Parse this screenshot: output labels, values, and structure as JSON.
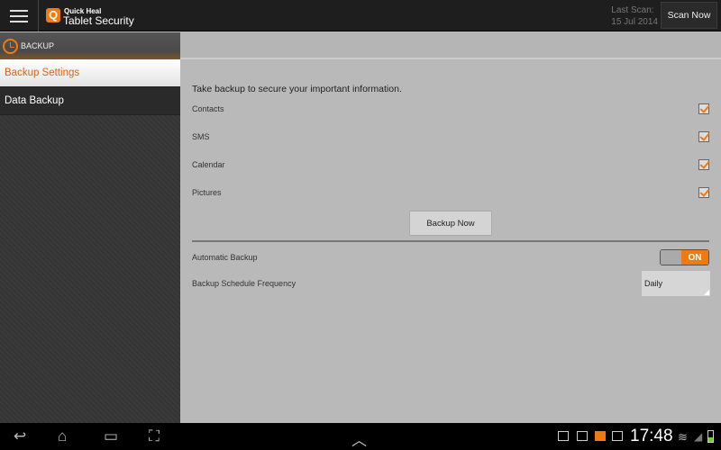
{
  "header": {
    "brand_top": "Quick Heal",
    "brand_bottom": "Tablet Security",
    "logo_letter": "Q",
    "last_scan_label": "Last Scan:",
    "last_scan_date": "15 Jul 2014",
    "scan_now": "Scan Now"
  },
  "sidebar": {
    "section": "BACKUP",
    "items": [
      {
        "label": "Backup Settings",
        "active": true
      },
      {
        "label": "Data Backup",
        "active": false
      }
    ]
  },
  "main": {
    "intro": "Take backup to secure your important information.",
    "items": [
      {
        "label": "Contacts",
        "checked": true
      },
      {
        "label": "SMS",
        "checked": true
      },
      {
        "label": "Calendar",
        "checked": true
      },
      {
        "label": "Pictures",
        "checked": true
      }
    ],
    "backup_now": "Backup Now",
    "automatic_backup": {
      "label": "Automatic Backup",
      "state": "ON"
    },
    "schedule": {
      "label": "Backup Schedule Frequency",
      "value": "Daily"
    }
  },
  "statusbar": {
    "time": "17:48"
  },
  "colors": {
    "accent": "#f07a10"
  }
}
